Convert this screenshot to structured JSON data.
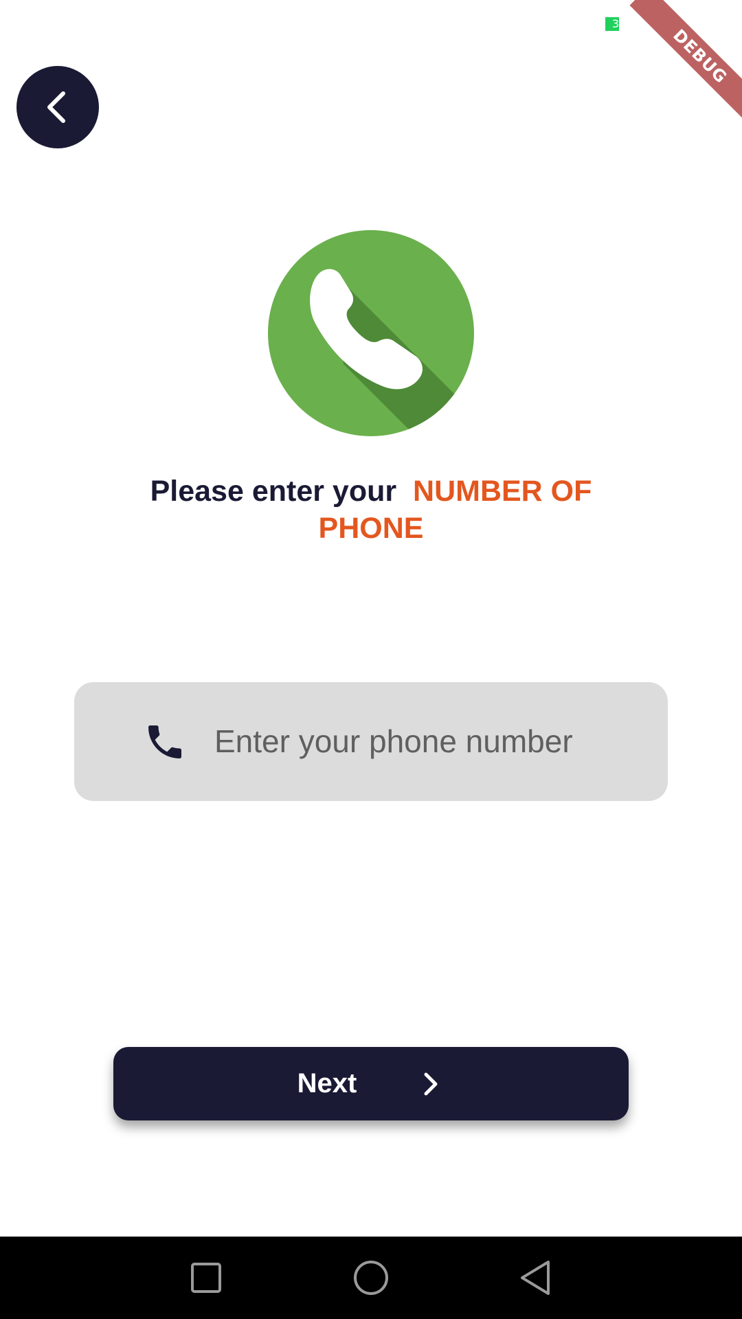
{
  "status_bar": {
    "indicator_text": "3",
    "indicator_color": "#1fd15c"
  },
  "debug_banner": {
    "label": "DEBUG"
  },
  "header": {
    "back_icon": "chevron-left-icon"
  },
  "hero": {
    "icon": "phone-handset-circle-icon",
    "color": "#6ab04c"
  },
  "headline": {
    "prefix": "Please enter your",
    "accent": "NUMBER OF PHONE",
    "accent_color": "#e3571f"
  },
  "phone_input": {
    "icon": "phone-icon",
    "placeholder": "Enter your phone number",
    "value": ""
  },
  "next_button": {
    "label": "Next",
    "icon": "chevron-right-icon"
  },
  "nav_bar": {
    "recents_icon": "square-icon",
    "home_icon": "circle-icon",
    "back_icon": "triangle-back-icon"
  },
  "colors": {
    "primary": "#1b1a35",
    "field_bg": "#dcdcdc"
  }
}
